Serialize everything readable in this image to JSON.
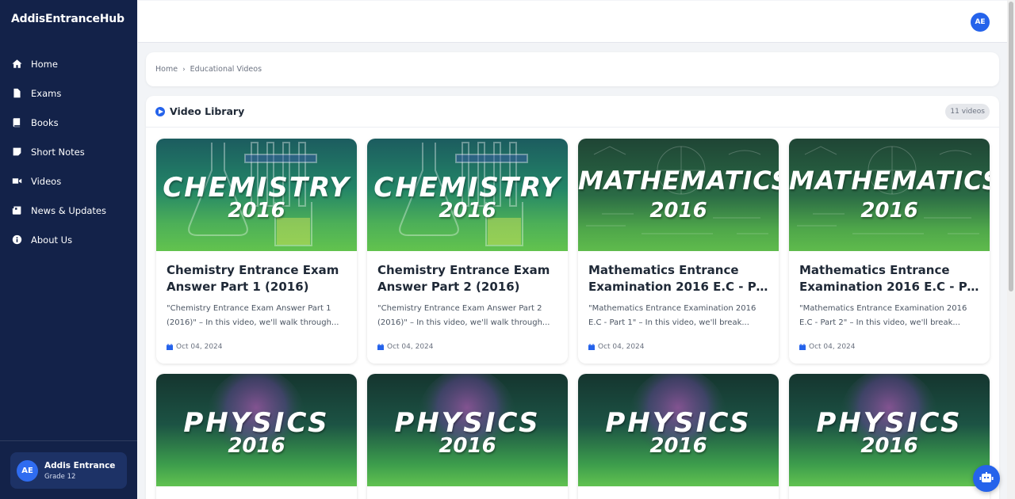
{
  "app": {
    "brand": "AddisEntranceHub"
  },
  "sidebar": {
    "items": [
      {
        "label": "Home",
        "icon": "home-icon"
      },
      {
        "label": "Exams",
        "icon": "document-icon"
      },
      {
        "label": "Books",
        "icon": "book-icon"
      },
      {
        "label": "Short Notes",
        "icon": "note-icon"
      },
      {
        "label": "Videos",
        "icon": "video-icon"
      },
      {
        "label": "News & Updates",
        "icon": "newspaper-icon"
      },
      {
        "label": "About Us",
        "icon": "info-icon"
      }
    ],
    "profile": {
      "initials": "AE",
      "name": "Addis Entrance",
      "grade": "Grade 12"
    }
  },
  "header": {
    "avatar_initials": "AE"
  },
  "breadcrumb": {
    "home": "Home",
    "current": "Educational Videos"
  },
  "library": {
    "title": "Video Library",
    "count": "11 videos",
    "videos": [
      {
        "subject": "CHEMISTRY",
        "year": "2016",
        "theme": "chem",
        "title_lines": [
          "Chemistry Entrance Exam",
          "Answer Part 1 (2016)"
        ],
        "desc_lines": [
          "\"Chemistry Entrance Exam Answer Part 1",
          "(2016)\" – In this video, we'll walk through..."
        ],
        "date": "Oct 04, 2024"
      },
      {
        "subject": "CHEMISTRY",
        "year": "2016",
        "theme": "chem",
        "title_lines": [
          "Chemistry Entrance Exam",
          "Answer Part 2 (2016)"
        ],
        "desc_lines": [
          "\"Chemistry Entrance Exam Answer Part 2",
          "(2016)\" – In this video, we'll walk through..."
        ],
        "date": "Oct 04, 2024"
      },
      {
        "subject": "MATHEMATICS",
        "year": "2016",
        "theme": "math",
        "title_lines": [
          "Mathematics Entrance",
          "Examination 2016 E.C - Par..."
        ],
        "desc_lines": [
          "\"Mathematics Entrance Examination 2016",
          "E.C - Part 1\" – In this video, we'll break..."
        ],
        "date": "Oct 04, 2024"
      },
      {
        "subject": "MATHEMATICS",
        "year": "2016",
        "theme": "math",
        "title_lines": [
          "Mathematics Entrance",
          "Examination 2016 E.C - Par..."
        ],
        "desc_lines": [
          "\"Mathematics Entrance Examination 2016",
          "E.C - Part 2\" – In this video, we'll break..."
        ],
        "date": "Oct 04, 2024"
      },
      {
        "subject": "PHYSICS",
        "year": "2016",
        "theme": "phys"
      },
      {
        "subject": "PHYSICS",
        "year": "2016",
        "theme": "phys"
      },
      {
        "subject": "PHYSICS",
        "year": "2016",
        "theme": "phys"
      },
      {
        "subject": "PHYSICS",
        "year": "2016",
        "theme": "phys"
      }
    ]
  },
  "colors": {
    "sidebar": "#132249",
    "accent": "#2563eb",
    "profile_card": "#1d3266"
  }
}
